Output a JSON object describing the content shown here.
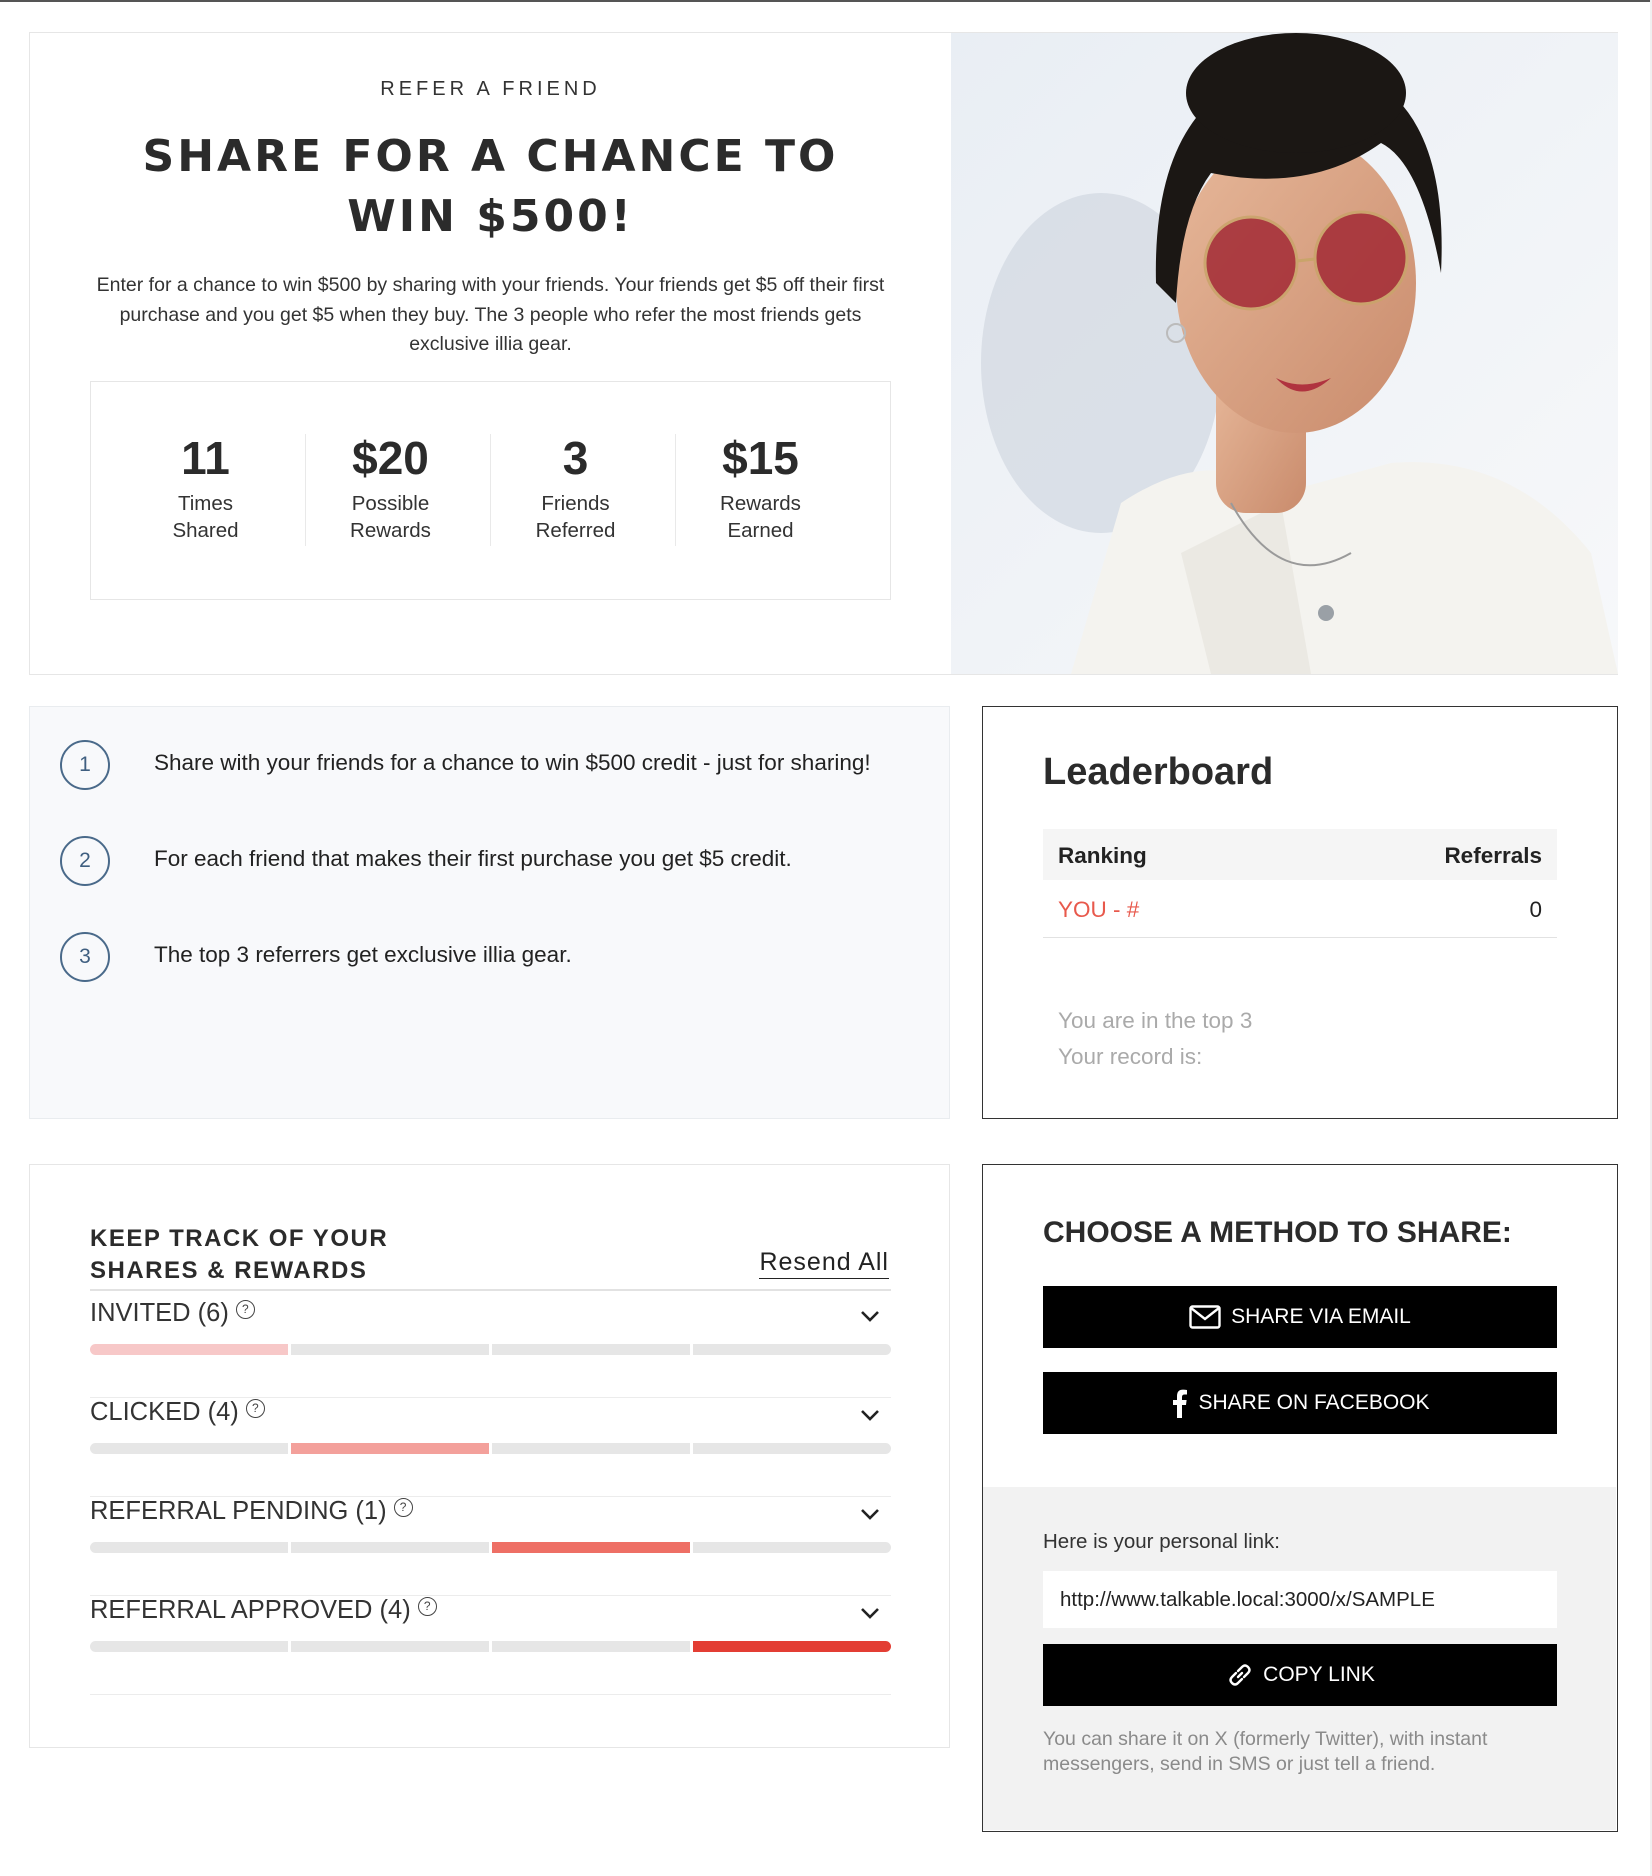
{
  "hero": {
    "eyebrow": "REFER A FRIEND",
    "title": "SHARE FOR A CHANCE TO WIN $500!",
    "description": "Enter for a chance to win $500 by sharing with your friends. Your friends get $5 off their first purchase and you get $5 when they buy. The 3 people who refer the most friends gets exclusive illia gear.",
    "stats": [
      {
        "value": "11",
        "label_line1": "Times",
        "label_line2": "Shared"
      },
      {
        "value": "$20",
        "label_line1": "Possible",
        "label_line2": "Rewards"
      },
      {
        "value": "3",
        "label_line1": "Friends",
        "label_line2": "Referred"
      },
      {
        "value": "$15",
        "label_line1": "Rewards",
        "label_line2": "Earned"
      }
    ]
  },
  "steps": [
    {
      "number": "1",
      "text": "Share with your friends for a chance to win $500 credit - just for sharing!"
    },
    {
      "number": "2",
      "text": "For each friend that makes their first purchase you get $5 credit."
    },
    {
      "number": "3",
      "text": "The top 3 referrers get exclusive illia gear."
    }
  ],
  "leaderboard": {
    "title": "Leaderboard",
    "col_ranking": "Ranking",
    "col_referrals": "Referrals",
    "you_label": "YOU - #",
    "you_count": "0",
    "note_line1": "You are in the top 3",
    "note_line2": "Your record is:"
  },
  "tracking": {
    "title_line1": "KEEP TRACK OF YOUR",
    "title_line2": "SHARES & REWARDS",
    "resend_label": "Resend All",
    "help_glyph": "?",
    "statuses": [
      {
        "label": "INVITED (6)",
        "active_segment": 0,
        "color": "#f7c8c8"
      },
      {
        "label": "CLICKED (4)",
        "active_segment": 1,
        "color": "#f3a09b"
      },
      {
        "label": "REFERRAL PENDING (1)",
        "active_segment": 2,
        "color": "#ee6f65"
      },
      {
        "label": "REFERRAL APPROVED (4)",
        "active_segment": 3,
        "color": "#e33e34"
      }
    ]
  },
  "share": {
    "title": "CHOOSE A METHOD TO SHARE:",
    "email_label": "SHARE VIA EMAIL",
    "facebook_label": "SHARE ON FACEBOOK",
    "personal_link_label": "Here is your personal link:",
    "personal_link": "http://www.talkable.local:3000/x/SAMPLE",
    "copy_label": "COPY LINK",
    "note": "You can share it on X (formerly Twitter), with instant messengers, send in SMS or just tell a friend."
  },
  "colors": {
    "accent_red": "#e8594c",
    "step_circle": "#4a6a8a",
    "button_black": "#000000"
  }
}
